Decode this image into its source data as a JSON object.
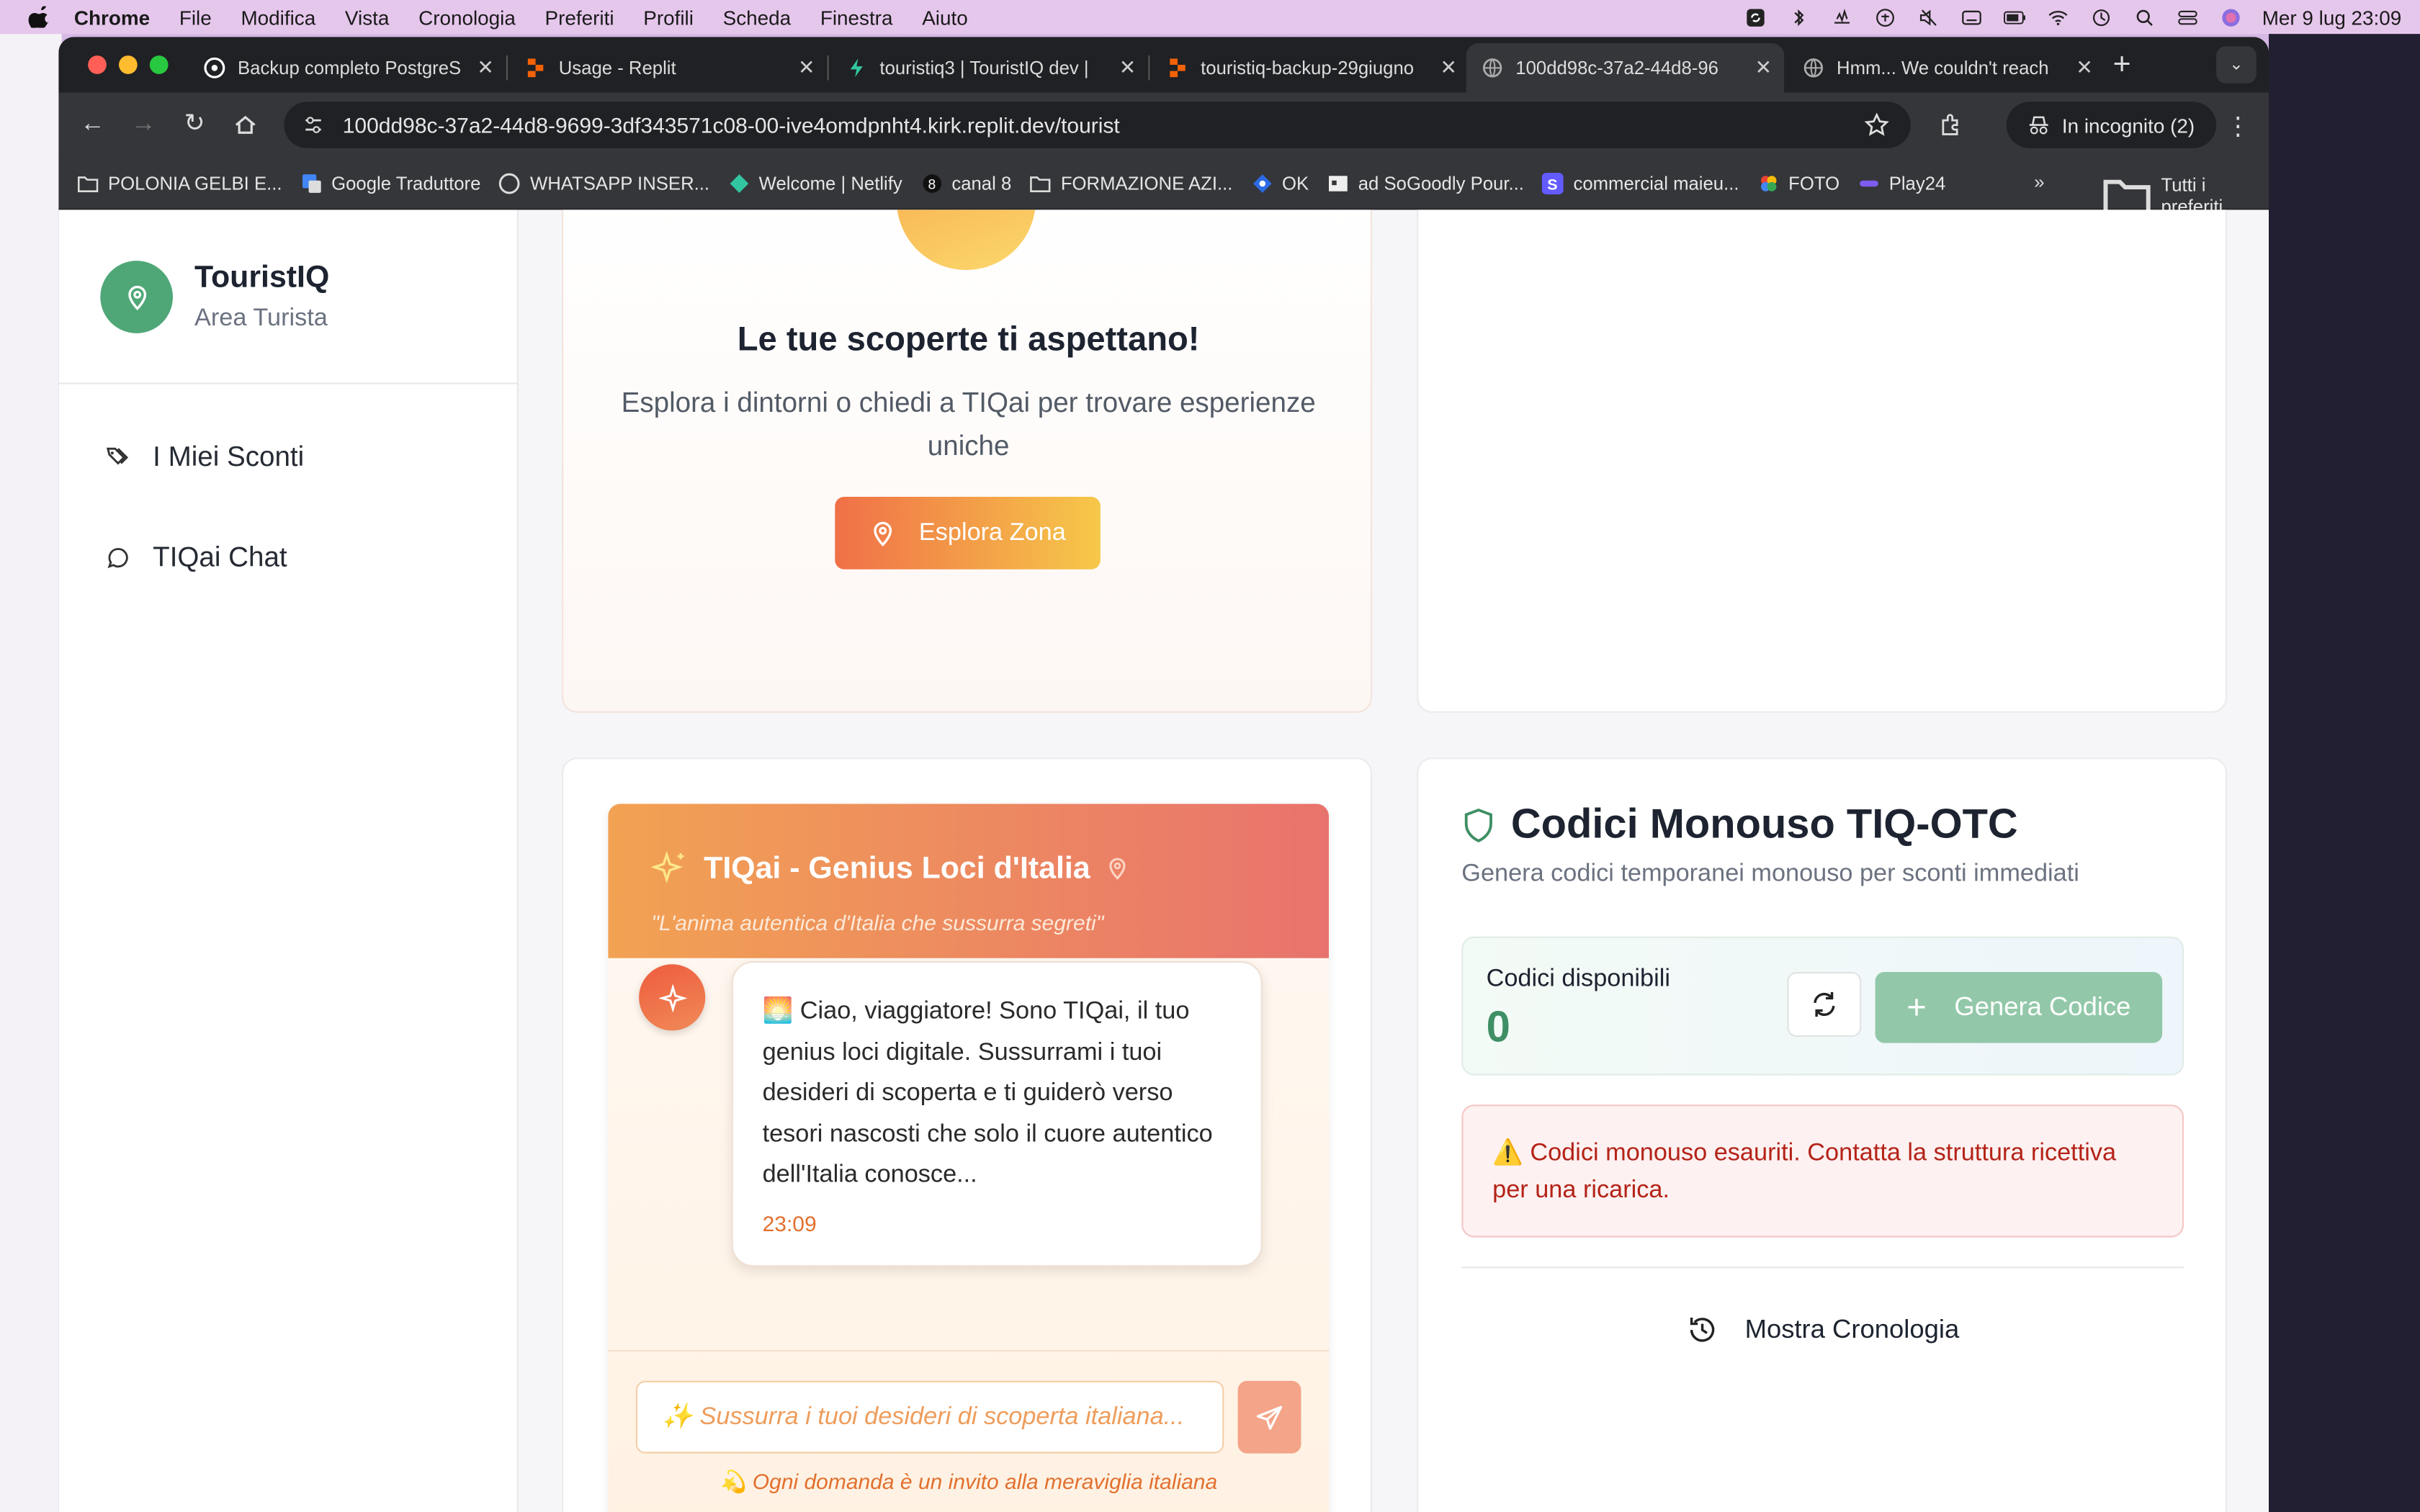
{
  "menubar": {
    "items": [
      "Chrome",
      "File",
      "Modifica",
      "Vista",
      "Cronologia",
      "Preferiti",
      "Profili",
      "Scheda",
      "Finestra",
      "Aiuto"
    ],
    "datetime": "Mer 9 lug  23:09"
  },
  "tabs": [
    {
      "title": "Backup completo PostgreS",
      "icon": "openai-icon"
    },
    {
      "title": "Usage - Replit",
      "icon": "replit-icon"
    },
    {
      "title": "touristiq3 | TouristIQ dev |",
      "icon": "netlify-icon"
    },
    {
      "title": "touristiq-backup-29giugno",
      "icon": "replit-icon"
    },
    {
      "title": "100dd98c-37a2-44d8-96",
      "icon": "globe-icon"
    },
    {
      "title": "Hmm... We couldn't reach",
      "icon": "globe-icon"
    }
  ],
  "toolbar": {
    "url": "100dd98c-37a2-44d8-9699-3df343571c08-00-ive4omdpnht4.kirk.replit.dev/tourist",
    "incognito": "In incognito (2)"
  },
  "bookmarks": {
    "items": [
      "POLONIA GELBI E...",
      "Google Traduttore",
      "WHATSAPP INSER...",
      "Welcome | Netlify",
      "canal 8",
      "FORMAZIONE AZI...",
      "OK",
      "ad SoGoodly Pour...",
      "commercial maieu...",
      "FOTO",
      "Play24"
    ],
    "all": "Tutti i preferiti"
  },
  "sidebar": {
    "brand": "TouristIQ",
    "subtitle": "Area Turista",
    "nav": [
      "I Miei Sconti",
      "TIQai Chat"
    ]
  },
  "discover": {
    "title": "Le tue scoperte ti aspettano!",
    "text": "Esplora i dintorni o chiedi a TIQai per trovare esperienze uniche",
    "button": "Esplora Zona"
  },
  "chat": {
    "title": "TIQai - Genius Loci d'Italia",
    "subtitle": "\"L'anima autentica d'Italia che sussurra segreti\"",
    "message": "🌅 Ciao, viaggiatore! Sono TIQai, il tuo genius loci digitale. Sussurrami i tuoi desideri di scoperta e ti guiderò verso tesori nascosti che solo il cuore autentico dell'Italia conosce...",
    "time": "23:09",
    "placeholder": "✨ Sussurra i tuoi desideri di scoperta italiana...",
    "hint": "💫 Ogni domanda è un invito alla meraviglia italiana"
  },
  "codes": {
    "title": "Codici Monouso TIQ-OTC",
    "subtitle": "Genera codici temporanei monouso per sconti immediati",
    "available_label": "Codici disponibili",
    "available_value": "0",
    "generate": "Genera Codice",
    "alert": "⚠️ Codici monouso esauriti. Contatta la struttura ricettiva per una ricarica.",
    "history": "Mostra Cronologia"
  },
  "colors": {
    "brand_green": "#4fa777",
    "orange": "#f07048",
    "alert_red": "#b42318"
  }
}
